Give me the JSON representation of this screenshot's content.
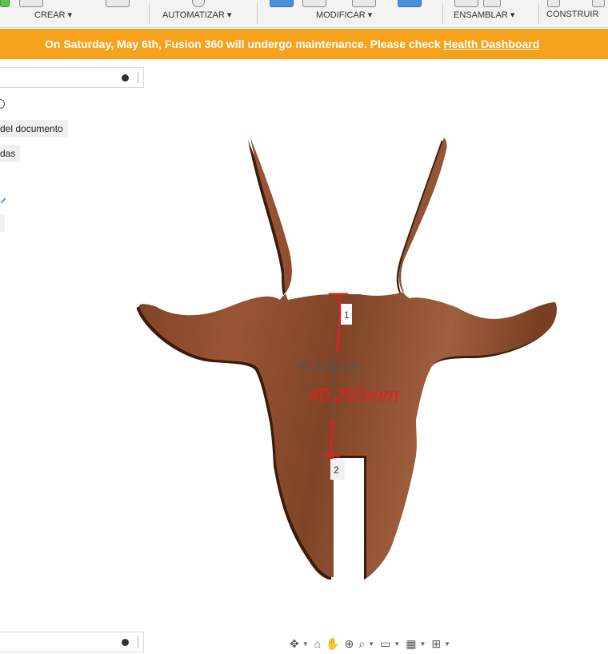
{
  "toolbar": {
    "groups": [
      {
        "label": "CREAR ▾"
      },
      {
        "label": "AUTOMATIZAR ▾"
      },
      {
        "label": "MODIFICAR ▾"
      },
      {
        "label": "ENSAMBLAR ▾"
      },
      {
        "label": "CONSTRUIR"
      }
    ]
  },
  "banner": {
    "message": "On Saturday, May 6th, Fusion 360 will undergo maintenance. Please check ",
    "link": "Health Dashboard"
  },
  "browser": {
    "items": [
      {
        "label": "del documento"
      },
      {
        "label": "das"
      }
    ]
  },
  "viewport": {
    "dimension_value": "40.265 mm",
    "handwritten_note": "40.265mm",
    "point_1": "1",
    "point_2": "2",
    "model_color": "#8b4a2b",
    "annotation_color": "#e0201e"
  },
  "navbar": {
    "icons": [
      "orbit-icon",
      "look-at-icon",
      "pan-icon",
      "zoom-icon",
      "fit-icon",
      "display-settings-icon",
      "grid-icon",
      "viewports-icon"
    ]
  }
}
